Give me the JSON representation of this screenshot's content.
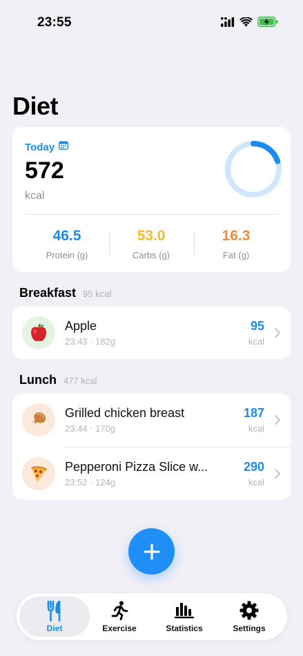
{
  "status": {
    "time": "23:55"
  },
  "page": {
    "title": "Diet"
  },
  "summary": {
    "today_label": "Today",
    "kcal_value": "572",
    "kcal_unit": "kcal",
    "progress": 0.2,
    "macros": [
      {
        "value": "46.5",
        "label": "Protein (g)",
        "color": "#1a8cf0"
      },
      {
        "value": "53.0",
        "label": "Carbs (g)",
        "color": "#f6b92b"
      },
      {
        "value": "16.3",
        "label": "Fat (g)",
        "color": "#f08a3c"
      }
    ]
  },
  "meals": [
    {
      "title": "Breakfast",
      "kcal": "95 kcal",
      "items": [
        {
          "name": "Apple",
          "meta": "23:43 · 182g",
          "kcal": "95",
          "unit": "kcal",
          "icon": "apple-icon"
        }
      ]
    },
    {
      "title": "Lunch",
      "kcal": "477 kcal",
      "items": [
        {
          "name": "Grilled chicken breast",
          "meta": "23:44 · 170g",
          "kcal": "187",
          "unit": "kcal",
          "icon": "chicken-leg-icon"
        },
        {
          "name": "Pepperoni Pizza Slice w...",
          "meta": "23:52 · 124g",
          "kcal": "290",
          "unit": "kcal",
          "icon": "pizza-icon"
        }
      ]
    }
  ],
  "tabs": [
    {
      "label": "Diet",
      "icon": "fork-knife-icon",
      "active": true
    },
    {
      "label": "Exercise",
      "icon": "running-icon",
      "active": false
    },
    {
      "label": "Statistics",
      "icon": "bar-chart-icon",
      "active": false
    },
    {
      "label": "Settings",
      "icon": "gear-icon",
      "active": false
    }
  ],
  "colors": {
    "accent": "#1a8cf0",
    "background": "#f1f0f6"
  }
}
